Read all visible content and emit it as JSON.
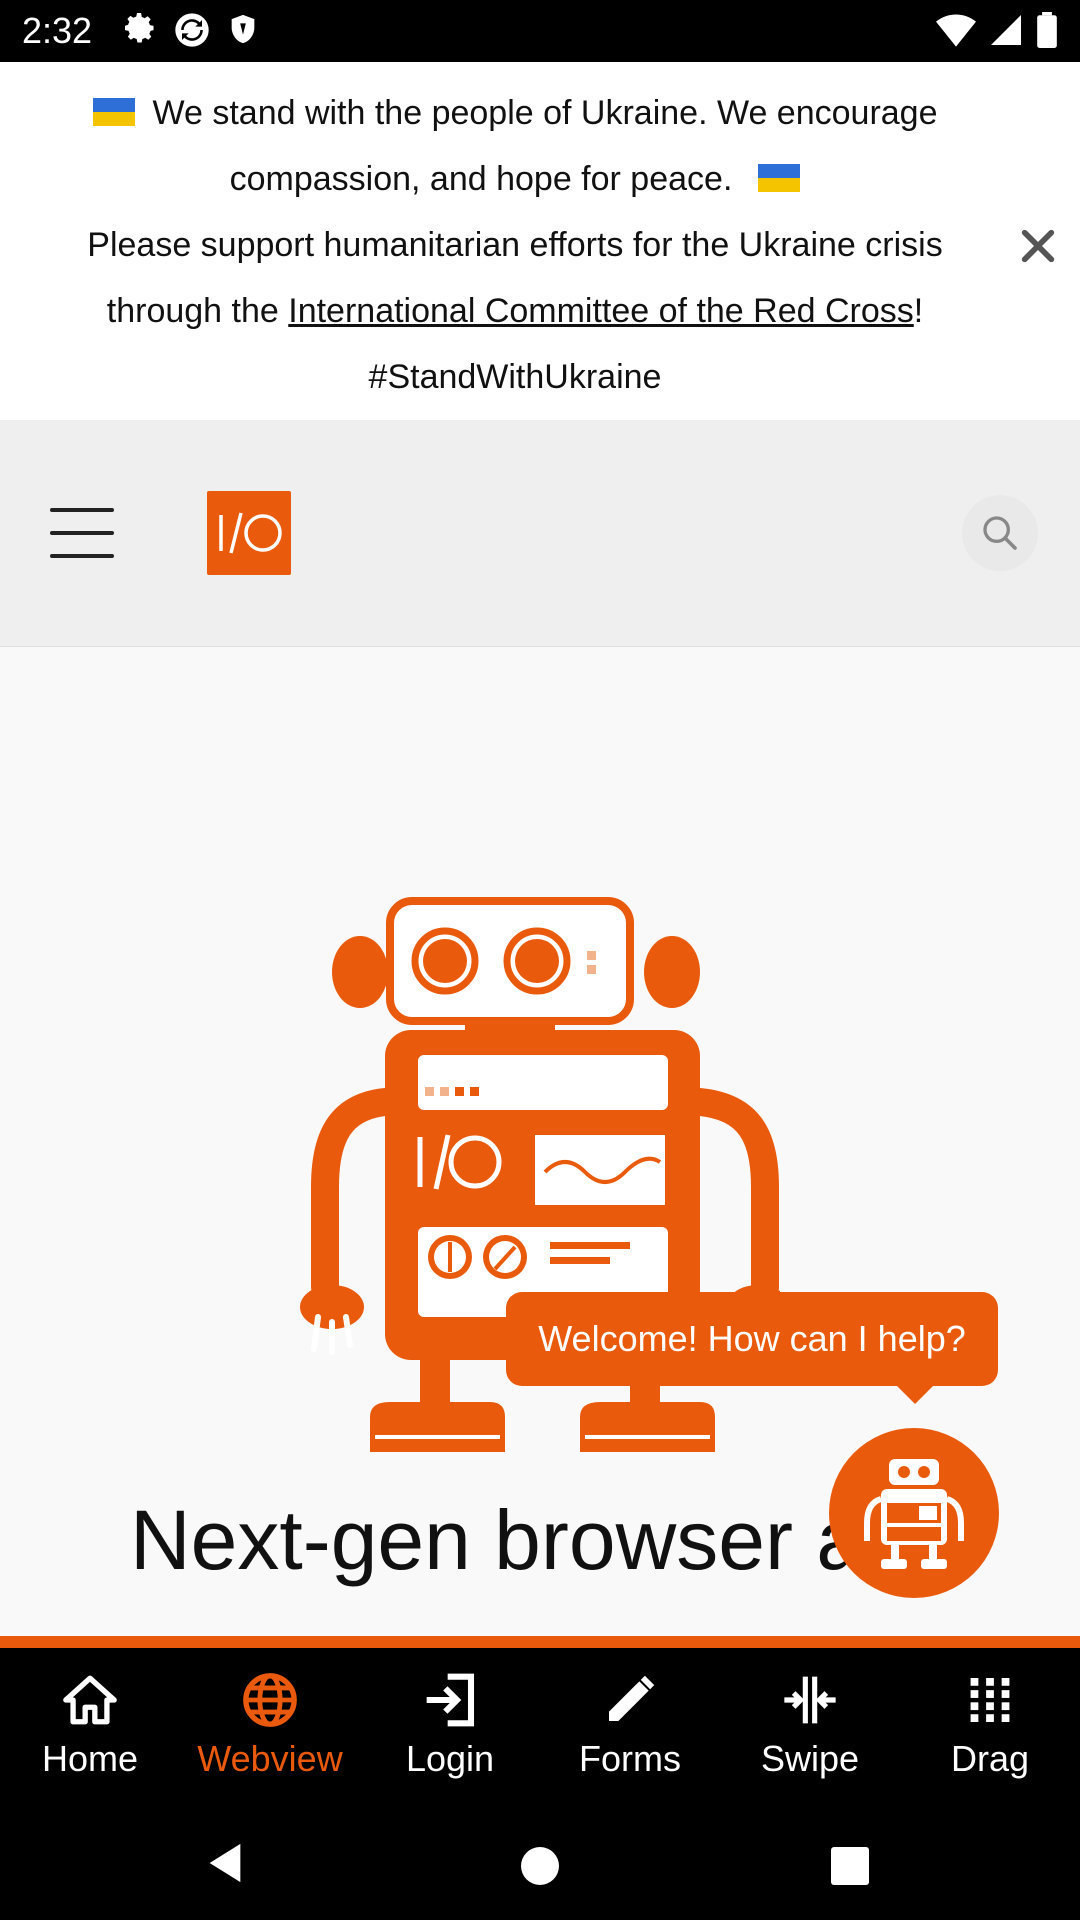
{
  "status": {
    "time": "2:32",
    "left_icons": [
      "gear-icon",
      "sync-icon",
      "shield-icon"
    ],
    "right_icons": [
      "wifi-icon",
      "signal-icon",
      "battery-icon"
    ]
  },
  "banner": {
    "line1": "We stand with the people of Ukraine. We encourage compassion, and hope for peace.",
    "line2_prefix": "Please support humanitarian efforts for the Ukraine crisis through the ",
    "link_text": "International Committee of the Red Cross",
    "line2_suffix": "!",
    "hashtag": "#StandWithUkraine",
    "flag_icon": "ukraine-flag-icon"
  },
  "header": {
    "logo_text": "I/O",
    "menu_icon": "hamburger-icon",
    "search_icon": "search-icon"
  },
  "main": {
    "headline": "Next-gen browser a",
    "robot_screen_text": "I/O"
  },
  "chat": {
    "bubble_text": "Welcome! How can I help?"
  },
  "tabs": [
    {
      "label": "Home",
      "icon": "home-icon",
      "active": false
    },
    {
      "label": "Webview",
      "icon": "globe-icon",
      "active": true
    },
    {
      "label": "Login",
      "icon": "login-icon",
      "active": false
    },
    {
      "label": "Forms",
      "icon": "pencil-icon",
      "active": false
    },
    {
      "label": "Swipe",
      "icon": "swipe-icon",
      "active": false
    },
    {
      "label": "Drag",
      "icon": "grid-icon",
      "active": false
    }
  ],
  "colors": {
    "accent": "#ea5a0c",
    "banner_bg": "#ffffff",
    "header_bg": "#efefef",
    "tabbar_bg": "#000000"
  }
}
